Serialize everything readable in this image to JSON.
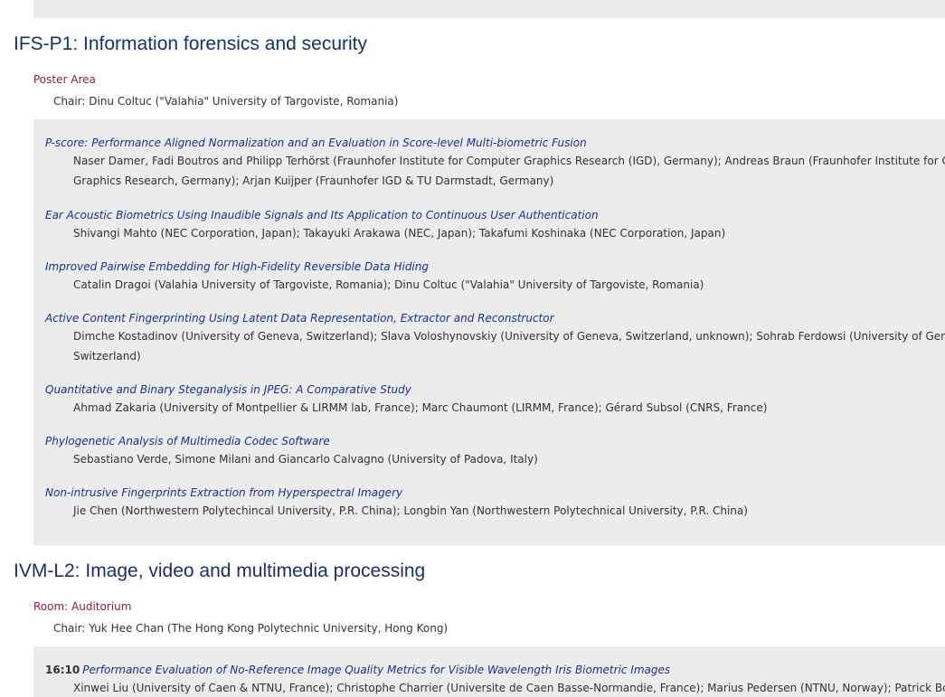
{
  "sessions": [
    {
      "title": "IFS-P1: Information forensics and security",
      "room": "Poster Area",
      "chair": "Chair: Dinu Coltuc (\"Valahia\" University of Targoviste, Romania)",
      "papers": [
        {
          "title": "P-score: Performance Aligned Normalization and an Evaluation in Score-level Multi-biometric Fusion",
          "authors_line1": "Naser Damer, Fadi Boutros and Philipp Terhörst (Fraunhofer Institute for Computer Graphics Research (IGD), Germany); Andreas Braun (Fraunhofer Institute for Computer",
          "authors_line2": "Graphics Research, Germany); Arjan Kuijper (Fraunhofer IGD & TU Darmstadt, Germany)"
        },
        {
          "title": "Ear Acoustic Biometrics Using Inaudible Signals and Its Application to Continuous User Authentication",
          "authors_line1": "Shivangi Mahto (NEC Corporation, Japan); Takayuki Arakawa (NEC, Japan); Takafumi Koshinaka (NEC Corporation, Japan)"
        },
        {
          "title": "Improved Pairwise Embedding for High-Fidelity Reversible Data Hiding",
          "authors_line1": "Catalin Dragoi (Valahia University of Targoviste, Romania); Dinu Coltuc (\"Valahia\" University of Targoviste, Romania)"
        },
        {
          "title": "Active Content Fingerprinting Using Latent Data Representation, Extractor and Reconstructor",
          "authors_line1": "Dimche Kostadinov (University of Geneva, Switzerland); Slava Voloshynovskiy (University of Geneva, Switzerland, unknown); Sohrab Ferdowsi (University of Geneva,",
          "authors_line2": "Switzerland)"
        },
        {
          "title": "Quantitative and Binary Steganalysis in JPEG: A Comparative Study",
          "authors_line1": "Ahmad Zakaria (University of Montpellier & LIRMM lab, France); Marc Chaumont (LIRMM, France); Gérard Subsol (CNRS, France)"
        },
        {
          "title": "Phylogenetic Analysis of Multimedia Codec Software",
          "authors_line1": "Sebastiano Verde, Simone Milani and Giancarlo Calvagno (University of Padova, Italy)"
        },
        {
          "title": "Non-intrusive Fingerprints Extraction from Hyperspectral Imagery",
          "authors_line1": "Jie Chen (Northwestern Polytechincal University, P.R. China); Longbin Yan (Northwestern Polytechnical University, P.R. China)"
        }
      ]
    },
    {
      "title": "IVM-L2: Image, video and multimedia processing",
      "room": "Room: Auditorium",
      "chair": "Chair: Yuk Hee Chan (The Hong Kong Polytechnic University, Hong Kong)",
      "papers": [
        {
          "time": "16:10",
          "title": "Performance Evaluation of No-Reference Image Quality Metrics for Visible Wavelength Iris Biometric Images",
          "authors_line1": "Xinwei Liu (University of Caen & NTNU, France); Christophe Charrier (Universite de Caen Basse-Normandie, France); Marius Pedersen (NTNU, Norway); Patrick Bours (NTNU, Norway)"
        }
      ]
    }
  ]
}
